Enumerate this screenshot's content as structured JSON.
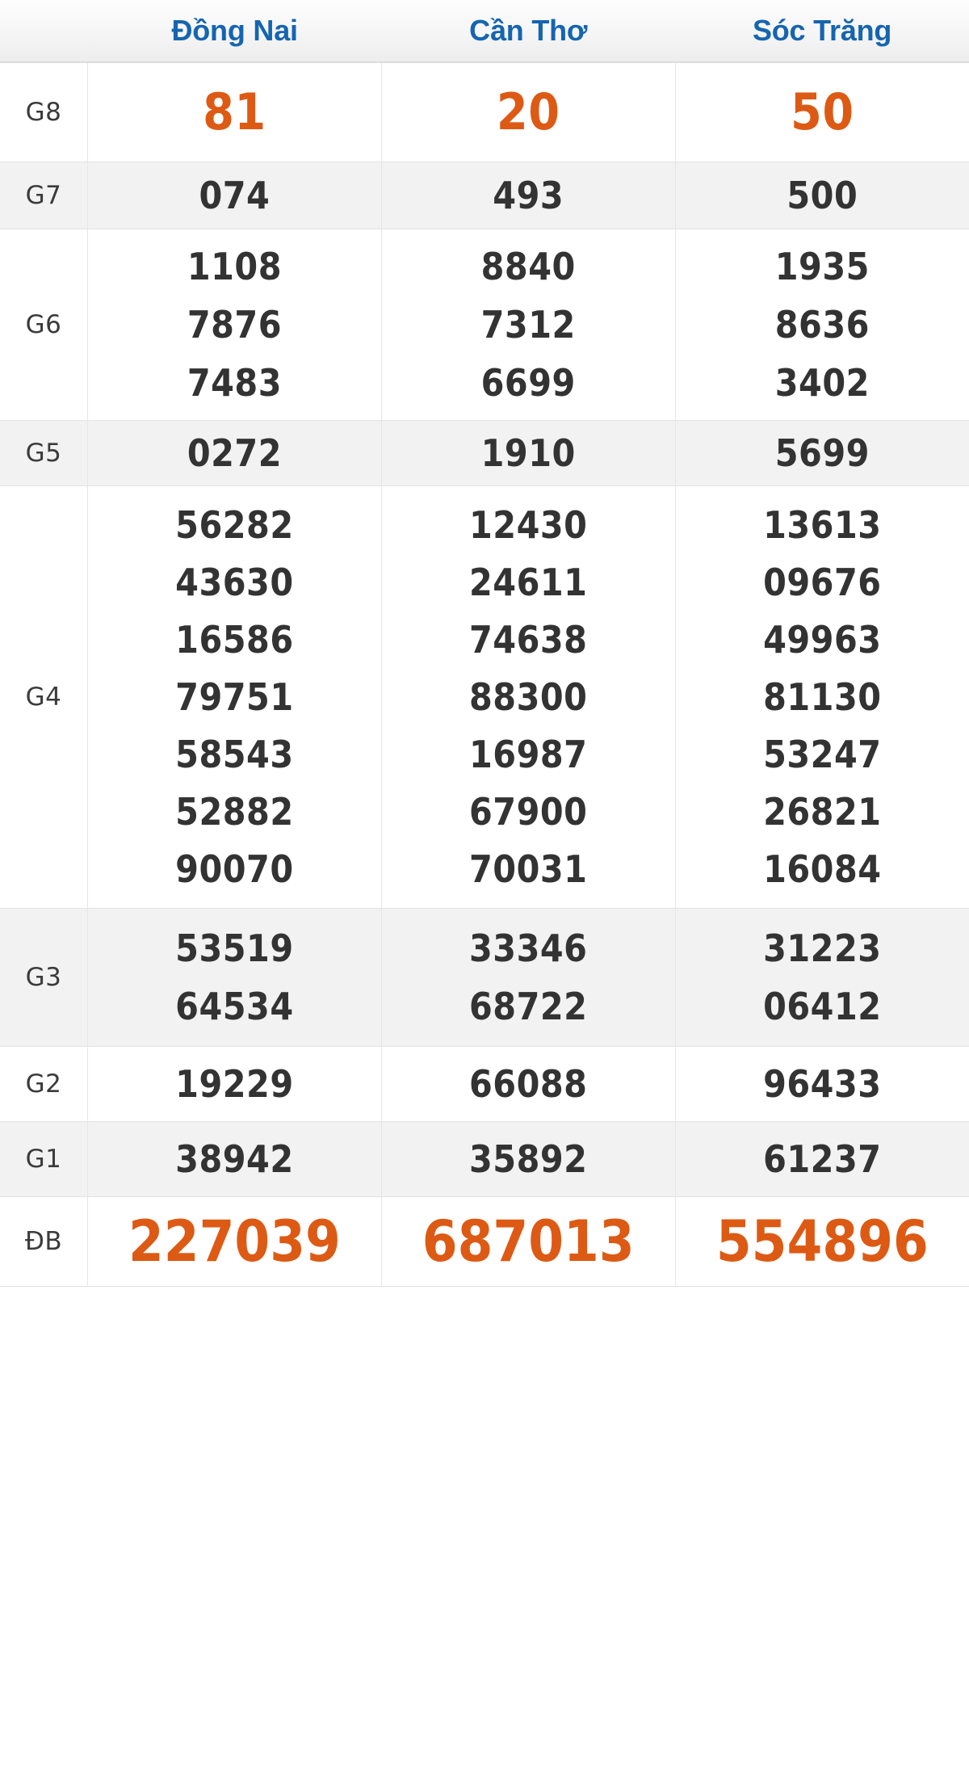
{
  "table": {
    "columns": [
      {
        "label": "Đồng Nai"
      },
      {
        "label": "Cần Thơ"
      },
      {
        "label": "Sóc Trăng"
      }
    ],
    "header_color": "#1565b0",
    "accent_color": "#dd5a14",
    "text_color": "#333333",
    "rows": [
      {
        "label": "G8",
        "style": "accent",
        "cells": [
          [
            "81"
          ],
          [
            "20"
          ],
          [
            "50"
          ]
        ]
      },
      {
        "label": "G7",
        "style": "normal",
        "cells": [
          [
            "074"
          ],
          [
            "493"
          ],
          [
            "500"
          ]
        ]
      },
      {
        "label": "G6",
        "style": "normal",
        "cells": [
          [
            "1108",
            "7876",
            "7483"
          ],
          [
            "8840",
            "7312",
            "6699"
          ],
          [
            "1935",
            "8636",
            "3402"
          ]
        ]
      },
      {
        "label": "G5",
        "style": "normal",
        "cells": [
          [
            "0272"
          ],
          [
            "1910"
          ],
          [
            "5699"
          ]
        ]
      },
      {
        "label": "G4",
        "style": "normal",
        "cells": [
          [
            "56282",
            "43630",
            "16586",
            "79751",
            "58543",
            "52882",
            "90070"
          ],
          [
            "12430",
            "24611",
            "74638",
            "88300",
            "16987",
            "67900",
            "70031"
          ],
          [
            "13613",
            "09676",
            "49963",
            "81130",
            "53247",
            "26821",
            "16084"
          ]
        ]
      },
      {
        "label": "G3",
        "style": "normal",
        "cells": [
          [
            "53519",
            "64534"
          ],
          [
            "33346",
            "68722"
          ],
          [
            "31223",
            "06412"
          ]
        ]
      },
      {
        "label": "G2",
        "style": "normal",
        "cells": [
          [
            "19229"
          ],
          [
            "66088"
          ],
          [
            "96433"
          ]
        ]
      },
      {
        "label": "G1",
        "style": "normal",
        "cells": [
          [
            "38942"
          ],
          [
            "35892"
          ],
          [
            "61237"
          ]
        ]
      },
      {
        "label": "ĐB",
        "style": "accent",
        "cells": [
          [
            "227039"
          ],
          [
            "687013"
          ],
          [
            "554896"
          ]
        ]
      }
    ]
  }
}
